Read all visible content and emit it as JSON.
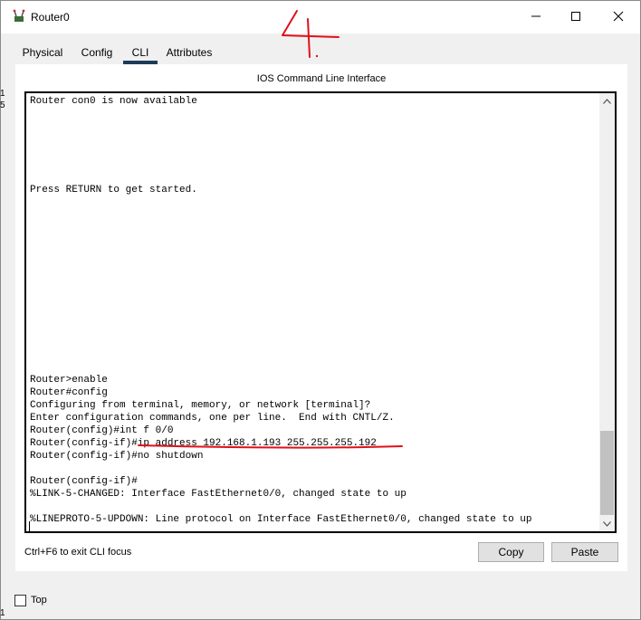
{
  "window": {
    "title": "Router0"
  },
  "tabs": [
    {
      "label": "Physical"
    },
    {
      "label": "Config"
    },
    {
      "label": "CLI"
    },
    {
      "label": "Attributes"
    }
  ],
  "active_tab": "CLI",
  "cli": {
    "heading": "IOS Command Line Interface",
    "lines": [
      "Router con0 is now available",
      "",
      "",
      "",
      "",
      "",
      "",
      "Press RETURN to get started.",
      "",
      "",
      "",
      "",
      "",
      "",
      "",
      "",
      "",
      "",
      "",
      "",
      "",
      "",
      "Router>enable",
      "Router#config",
      "Configuring from terminal, memory, or network [terminal]?",
      "Enter configuration commands, one per line.  End with CNTL/Z.",
      "Router(config)#int f 0/0",
      "Router(config-if)#ip address 192.168.1.193 255.255.255.192",
      "Router(config-if)#no shutdown",
      "",
      "Router(config-if)#",
      "%LINK-5-CHANGED: Interface FastEthernet0/0, changed state to up",
      "",
      "%LINEPROTO-5-UPDOWN: Line protocol on Interface FastEthernet0/0, changed state to up"
    ],
    "exit_hint": "Ctrl+F6 to exit CLI focus",
    "copy_label": "Copy",
    "paste_label": "Paste"
  },
  "footer": {
    "top_label": "Top",
    "top_checked": false
  },
  "annotation": {
    "handwritten": "4",
    "color": "#e0101a"
  },
  "edge_marks": [
    "1",
    "5",
    "1"
  ]
}
